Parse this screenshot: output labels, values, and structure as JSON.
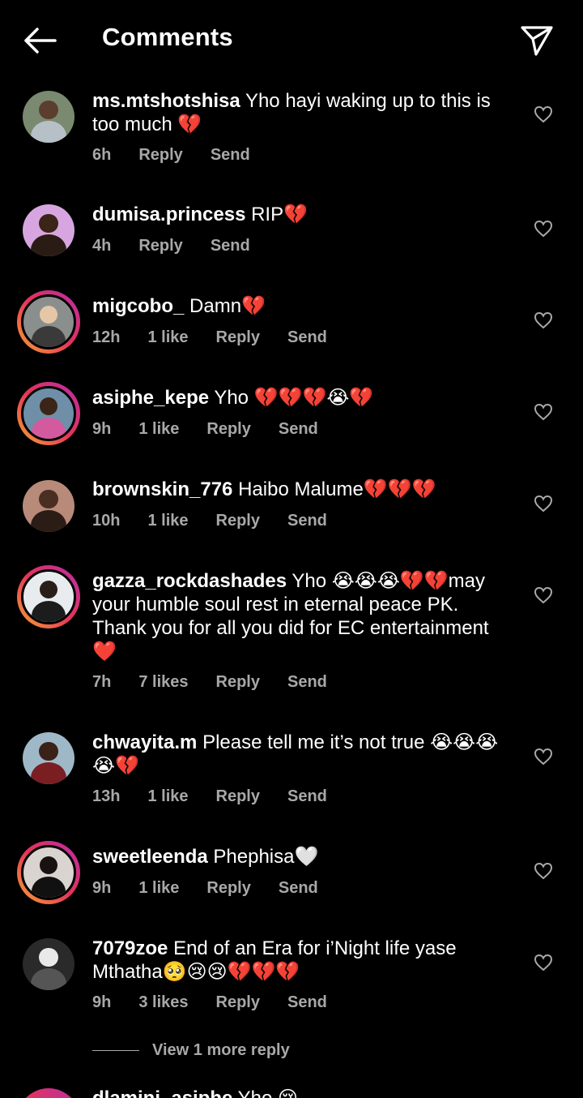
{
  "header": {
    "title": "Comments",
    "back_icon": "arrow-left-icon",
    "send_icon": "paper-plane-icon"
  },
  "labels": {
    "reply": "Reply",
    "send": "Send"
  },
  "comments": [
    {
      "username": "ms.mtshotshisa",
      "text": "Yho hayi waking up to this is too much 💔",
      "time": "6h",
      "likes": "",
      "ring": false
    },
    {
      "username": "dumisa.princess",
      "text": "RIP💔",
      "time": "4h",
      "likes": "",
      "ring": false
    },
    {
      "username": "migcobo_",
      "text": "Damn💔",
      "time": "12h",
      "likes": "1 like",
      "ring": true
    },
    {
      "username": "asiphe_kepe",
      "text": "Yho 💔💔💔😭💔",
      "time": "9h",
      "likes": "1 like",
      "ring": true
    },
    {
      "username": "brownskin_776",
      "text": "Haibo Malume💔💔💔",
      "time": "10h",
      "likes": "1 like",
      "ring": false
    },
    {
      "username": "gazza_rockdashades",
      "text": "Yho 😭😭😭💔💔may your humble soul rest in eternal peace PK. Thank you for all you did for EC entertainment ❤️",
      "time": "7h",
      "likes": "7 likes",
      "ring": true
    },
    {
      "username": "chwayita.m",
      "text": "Please tell me it’s not true 😭😭😭😭💔",
      "time": "13h",
      "likes": "1 like",
      "ring": false
    },
    {
      "username": "sweetleenda",
      "text": "Phephisa🤍",
      "time": "9h",
      "likes": "1 like",
      "ring": true
    },
    {
      "username": "7079zoe",
      "text": "End of an Era for i’Night life yase Mthatha🥺😢😢💔💔💔",
      "time": "9h",
      "likes": "3 likes",
      "ring": false
    }
  ],
  "view_more": "View 1 more reply",
  "partial_comment": {
    "username": "dlamini_asiphe",
    "text": "Yho 😢"
  },
  "colors": {
    "background": "#000000",
    "secondary_text": "#a8a8a8",
    "ring_start": "#f7a531",
    "ring_end": "#b72da8"
  }
}
